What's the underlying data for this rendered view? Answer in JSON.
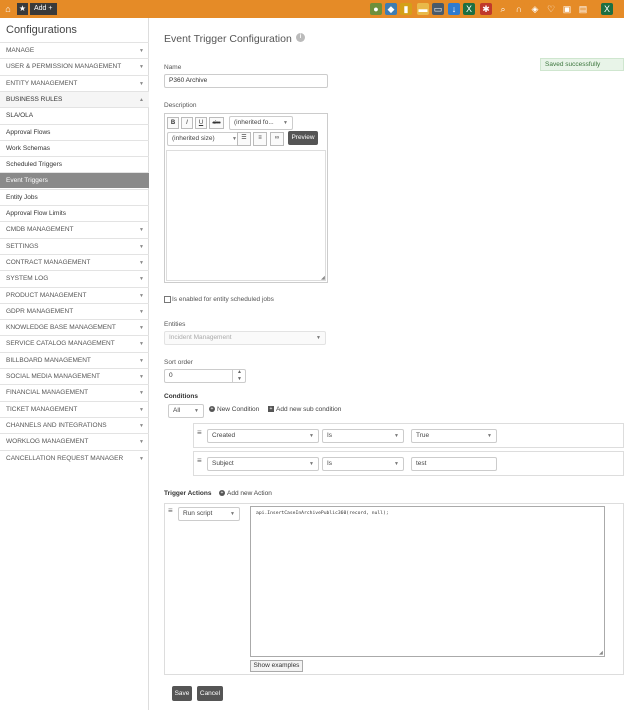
{
  "topbar": {
    "add_label": "Add",
    "icons": [
      {
        "name": "bulb-icon",
        "color": "#6d8f3b",
        "glyph": "●"
      },
      {
        "name": "map-icon",
        "color": "#3e7cb1",
        "glyph": "◆"
      },
      {
        "name": "chart-icon",
        "color": "#d4a017",
        "glyph": "▮"
      },
      {
        "name": "folder-icon",
        "color": "#e9b949",
        "glyph": "▬"
      },
      {
        "name": "laptop-icon",
        "color": "#4a5a6a",
        "glyph": "▭"
      },
      {
        "name": "download-icon",
        "color": "#2e7bcf",
        "glyph": "↓"
      },
      {
        "name": "excel-icon",
        "color": "#1d6f42",
        "glyph": "X"
      },
      {
        "name": "puzzle-icon",
        "color": "#c0392b",
        "glyph": "✱"
      },
      {
        "name": "search-icon",
        "color": "#e58b27",
        "glyph": "⌕"
      },
      {
        "name": "headset-icon",
        "color": "#e58b27",
        "glyph": "∩"
      },
      {
        "name": "tag-icon",
        "color": "#e58b27",
        "glyph": "◈"
      },
      {
        "name": "heart-icon",
        "color": "#e58b27",
        "glyph": "♡"
      },
      {
        "name": "calendar-icon",
        "color": "#e58b27",
        "glyph": "▣"
      },
      {
        "name": "chat-icon",
        "color": "#e58b27",
        "glyph": "▤"
      },
      {
        "name": "excel-profile-icon",
        "color": "#1d6f42",
        "glyph": "X"
      }
    ]
  },
  "sidebar": {
    "title": "Configurations",
    "items": [
      {
        "label": "MANAGE",
        "caret": "▼",
        "kind": "section"
      },
      {
        "label": "USER & PERMISSION MANAGEMENT",
        "caret": "▼",
        "kind": "section"
      },
      {
        "label": "ENTITY MANAGEMENT",
        "caret": "▼",
        "kind": "section"
      },
      {
        "label": "BUSINESS RULES",
        "caret": "▲",
        "kind": "open"
      },
      {
        "label": "SLA/OLA",
        "caret": "",
        "kind": "sub"
      },
      {
        "label": "Approval Flows",
        "caret": "",
        "kind": "sub"
      },
      {
        "label": "Work Schemas",
        "caret": "",
        "kind": "sub"
      },
      {
        "label": "Scheduled Triggers",
        "caret": "",
        "kind": "sub"
      },
      {
        "label": "Event Triggers",
        "caret": "",
        "kind": "active"
      },
      {
        "label": "Entity Jobs",
        "caret": "",
        "kind": "sub"
      },
      {
        "label": "Approval Flow Limits",
        "caret": "",
        "kind": "sub"
      },
      {
        "label": "CMDB MANAGEMENT",
        "caret": "▼",
        "kind": "section"
      },
      {
        "label": "SETTINGS",
        "caret": "▼",
        "kind": "section"
      },
      {
        "label": "CONTRACT MANAGEMENT",
        "caret": "▼",
        "kind": "section"
      },
      {
        "label": "SYSTEM LOG",
        "caret": "▼",
        "kind": "section"
      },
      {
        "label": "PRODUCT MANAGEMENT",
        "caret": "▼",
        "kind": "section"
      },
      {
        "label": "GDPR MANAGEMENT",
        "caret": "▼",
        "kind": "section"
      },
      {
        "label": "KNOWLEDGE BASE MANAGEMENT",
        "caret": "▼",
        "kind": "section"
      },
      {
        "label": "SERVICE CATALOG MANAGEMENT",
        "caret": "▼",
        "kind": "section"
      },
      {
        "label": "BILLBOARD MANAGEMENT",
        "caret": "▼",
        "kind": "section"
      },
      {
        "label": "SOCIAL MEDIA MANAGEMENT",
        "caret": "▼",
        "kind": "section"
      },
      {
        "label": "FINANCIAL MANAGEMENT",
        "caret": "▼",
        "kind": "section"
      },
      {
        "label": "TICKET MANAGEMENT",
        "caret": "▼",
        "kind": "section"
      },
      {
        "label": "CHANNELS AND INTEGRATIONS",
        "caret": "▼",
        "kind": "section"
      },
      {
        "label": "WORKLOG MANAGEMENT",
        "caret": "▼",
        "kind": "section"
      },
      {
        "label": "CANCELLATION REQUEST MANAGER",
        "caret": "▼",
        "kind": "section"
      }
    ]
  },
  "main": {
    "title": "Event Trigger Configuration",
    "saved_message": "Saved successfully",
    "name_label": "Name",
    "name_value": "P360 Archive",
    "description_label": "Description",
    "editor": {
      "bold": "B",
      "italic": "I",
      "underline": "U",
      "strike": "abc",
      "font_family": "(inherited fo...",
      "font_size": "(inherited size)",
      "preview": "Preview"
    },
    "scheduled_jobs_label": "Is enabled for entity scheduled jobs",
    "entities_label": "Entities",
    "entities_value": "Incident Management",
    "sort_order_label": "Sort order",
    "sort_order_value": "0",
    "conditions_label": "Conditions",
    "conditions_mode": "All",
    "new_condition": "New Condition",
    "new_sub_condition": "Add new sub condition",
    "conditions": [
      {
        "field": "Created",
        "operator": "Is",
        "value": "True"
      },
      {
        "field": "Subject",
        "operator": "Is",
        "value": "test"
      }
    ],
    "trigger_actions_label": "Trigger Actions",
    "add_new_action": "Add new Action",
    "action_type": "Run script",
    "script": "api.InsertCaseInArchivePublic360(record, null);",
    "show_examples": "Show examples",
    "save": "Save",
    "cancel": "Cancel"
  }
}
